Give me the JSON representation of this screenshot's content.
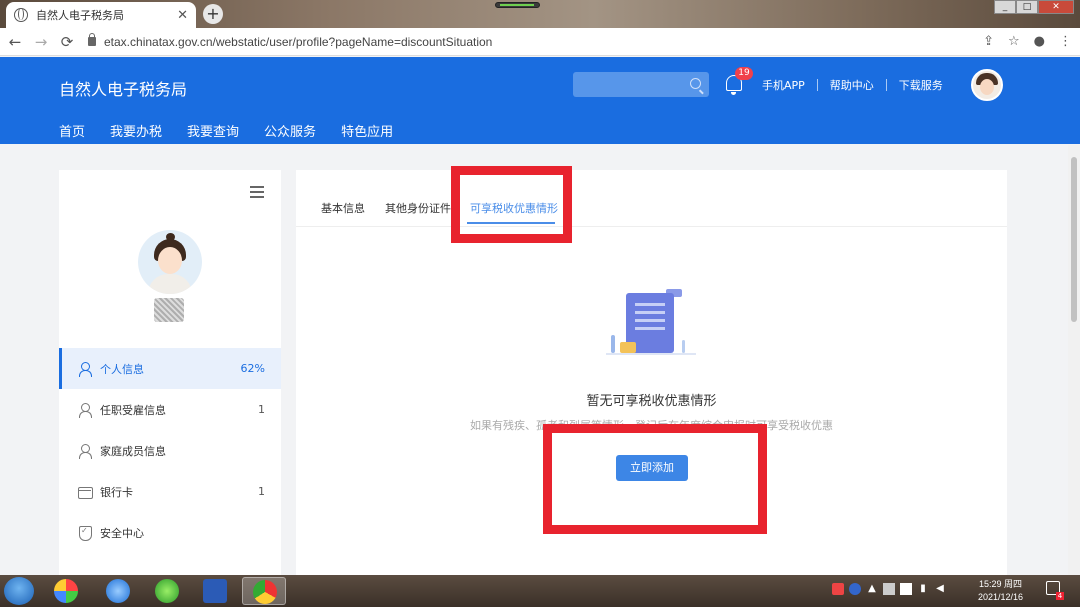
{
  "browser": {
    "tab_title": "自然人电子税务局",
    "tab_close": "✕",
    "new_tab": "+",
    "url": "etax.chinatax.gov.cn/webstatic/user/profile?pageName=discountSituation",
    "back": "←",
    "forward": "→",
    "reload": "⟳",
    "share": "⇪",
    "star": "☆",
    "profile": "●",
    "more": "⋮",
    "win_min": "_",
    "win_max": "□",
    "win_close": "✕"
  },
  "header": {
    "title": "自然人电子税务局",
    "search_placeholder": "",
    "notification_count": "19",
    "links": [
      "手机APP",
      "帮助中心",
      "下载服务"
    ],
    "nav": [
      "首页",
      "我要办税",
      "我要查询",
      "公众服务",
      "特色应用"
    ]
  },
  "sidebar": {
    "items": [
      {
        "label": "个人信息",
        "value": "62%"
      },
      {
        "label": "任职受雇信息",
        "value": "1"
      },
      {
        "label": "家庭成员信息",
        "value": ""
      },
      {
        "label": "银行卡",
        "value": "1"
      },
      {
        "label": "安全中心",
        "value": ""
      }
    ]
  },
  "main": {
    "tabs": [
      "基本信息",
      "其他身份证件",
      "可享税收优惠情形"
    ],
    "active_tab": 2,
    "empty_title": "暂无可享税收优惠情形",
    "empty_subtitle": "如果有残疾、孤老和烈属等情形，登记后在年度综合申报时可享受税收优惠",
    "add_button": "立即添加"
  },
  "taskbar": {
    "time": "15:29 周四",
    "date": "2021/12/16",
    "notify_badge": "4"
  },
  "colors": {
    "brand_blue": "#1a6de0",
    "highlight_red": "#e8232e",
    "tab_active": "#4a8de8"
  }
}
